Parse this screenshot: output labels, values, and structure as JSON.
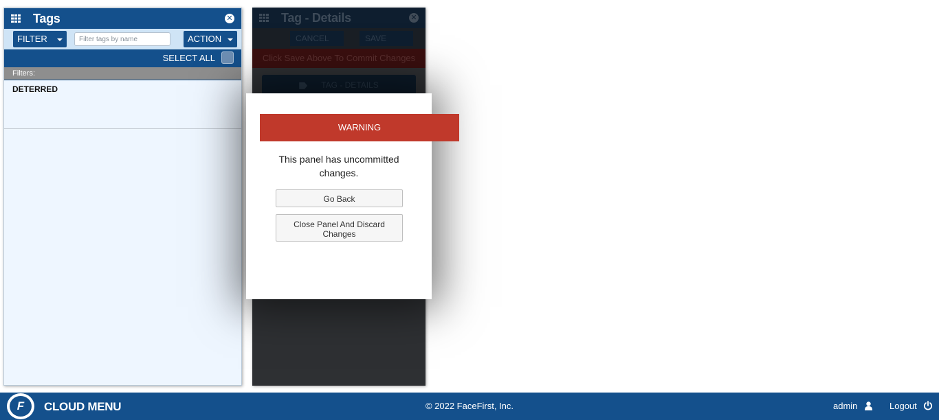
{
  "tags_panel": {
    "title": "Tags",
    "close_icon": "close-circle-icon",
    "filter_button": "FILTER",
    "search": {
      "placeholder": "Filter tags by name",
      "value": ""
    },
    "action_button": "ACTION",
    "select_all_label": "SELECT ALL",
    "filters_label": "Filters:",
    "filter_tags": [
      "DETERRED"
    ]
  },
  "details_panel": {
    "title": "Tag - Details",
    "cancel_label": "CANCEL",
    "save_label": "SAVE",
    "commit_message": "Click Save Above To Commit Changes",
    "details_tab_label": "TAG - DETAILS"
  },
  "modal": {
    "header": "WARNING",
    "message": "This panel has uncommitted changes.",
    "go_back_label": "Go Back",
    "discard_label": "Close Panel And Discard Changes"
  },
  "footer": {
    "menu_label": "CLOUD MENU",
    "copyright": "© 2022 FaceFirst, Inc.",
    "username": "admin",
    "logout_label": "Logout"
  },
  "colors": {
    "primary_blue": "#14508c",
    "warning_red": "#c0392b",
    "panel_bg": "#eef6ff"
  }
}
